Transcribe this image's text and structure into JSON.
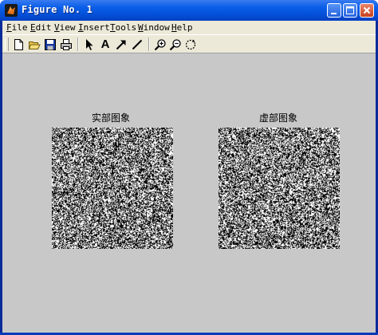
{
  "window": {
    "title": "Figure No. 1"
  },
  "menubar": {
    "items": [
      {
        "underline": "F",
        "rest": "ile"
      },
      {
        "underline": "E",
        "rest": "dit"
      },
      {
        "underline": "V",
        "rest": "iew"
      },
      {
        "underline": "I",
        "rest": "nsert"
      },
      {
        "underline": "T",
        "rest": "ools"
      },
      {
        "underline": "W",
        "rest": "indow"
      },
      {
        "underline": "H",
        "rest": "elp"
      }
    ]
  },
  "toolbar": {
    "tools": [
      "new-file-icon",
      "open-folder-icon",
      "save-icon",
      "print-icon",
      "select-arrow-icon",
      "text-icon",
      "arrow-icon",
      "line-icon",
      "zoom-in-icon",
      "zoom-out-icon",
      "rotate-icon"
    ],
    "text_tool_label": "A"
  },
  "figure": {
    "axes": [
      {
        "title": "实部图象"
      },
      {
        "title": "虚部图象"
      }
    ],
    "colormap": [
      "#000000",
      "#ffffff"
    ]
  },
  "colors": {
    "titlebar": "#0450d8",
    "menubar": "#ece9d8",
    "figure_background": "#c8c8c8"
  }
}
